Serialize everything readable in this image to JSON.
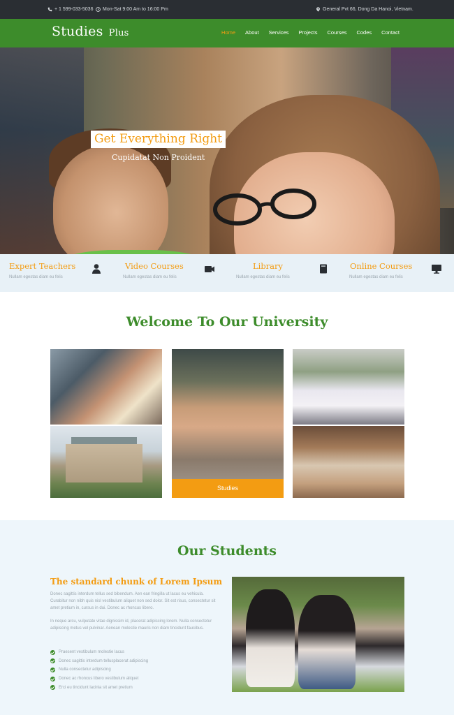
{
  "topbar": {
    "phone": "+ 1 599-033-5036",
    "hours": "Mon-Sat 9:00 Am to 16:00 Pm",
    "address": "General Pvt 66, Dong Da Hanoi, Vietnam."
  },
  "brand": {
    "name": "Studies",
    "suffix": "Plus"
  },
  "nav": {
    "items": [
      "Home",
      "About",
      "Services",
      "Projects",
      "Courses",
      "Codes",
      "Contact"
    ],
    "active": "Home",
    "active_color": "#f39c12"
  },
  "hero": {
    "badge": "Get Everything Right",
    "subtitle": "Cupidatat Non Proident"
  },
  "features": [
    {
      "title": "Expert Teachers",
      "text": "Nullam egestas diam eu felis",
      "icon": "user-icon"
    },
    {
      "title": "Video Courses",
      "text": "Nullam egestas diam eu felis",
      "icon": "video-camera-icon"
    },
    {
      "title": "Library",
      "text": "Nullam egestas diam eu felis",
      "icon": "book-icon"
    },
    {
      "title": "Online Courses",
      "text": "Nullam egestas diam eu felis",
      "icon": "desktop-icon"
    }
  ],
  "welcome": {
    "title": "Welcome To Our University",
    "caption": "Studies"
  },
  "students": {
    "title": "Our Students",
    "subtitle": "The standard chunk of Lorem Ipsum",
    "para1": "Donec sagittis interdum tellus sed bibendum. Aen ean fringilla ut lacus eu vehicula. Curabitur non nibh quis nisl vestibulum aliquet non sed dolor. Sit est risus, consectetur sit amet pretium in, cursus in dui. Donec ac rhoncus libero.",
    "para2": "In neque arcu, vulputate vitae dignissim id, placerat adipiscing lorem. Nulla consectetur adipiscing metus vel pulvinar. Aenean molestie mauris non diam tincidunt faucibus.",
    "checklist": [
      "Praesent vestibulum molestie lacus",
      "Donec sagittis interdum tellusplacerat adipiscing",
      "Nulla consectetur adipiscing",
      "Donec ac rhoncus libero vestibulum aliquet",
      "Erci eu tincidunt lacinia sit amet pretium"
    ]
  },
  "colors": {
    "green": "#3d8c2b",
    "orange": "#f39c12",
    "dark": "#2a2e33",
    "light_blue": "#e8f1f7"
  }
}
